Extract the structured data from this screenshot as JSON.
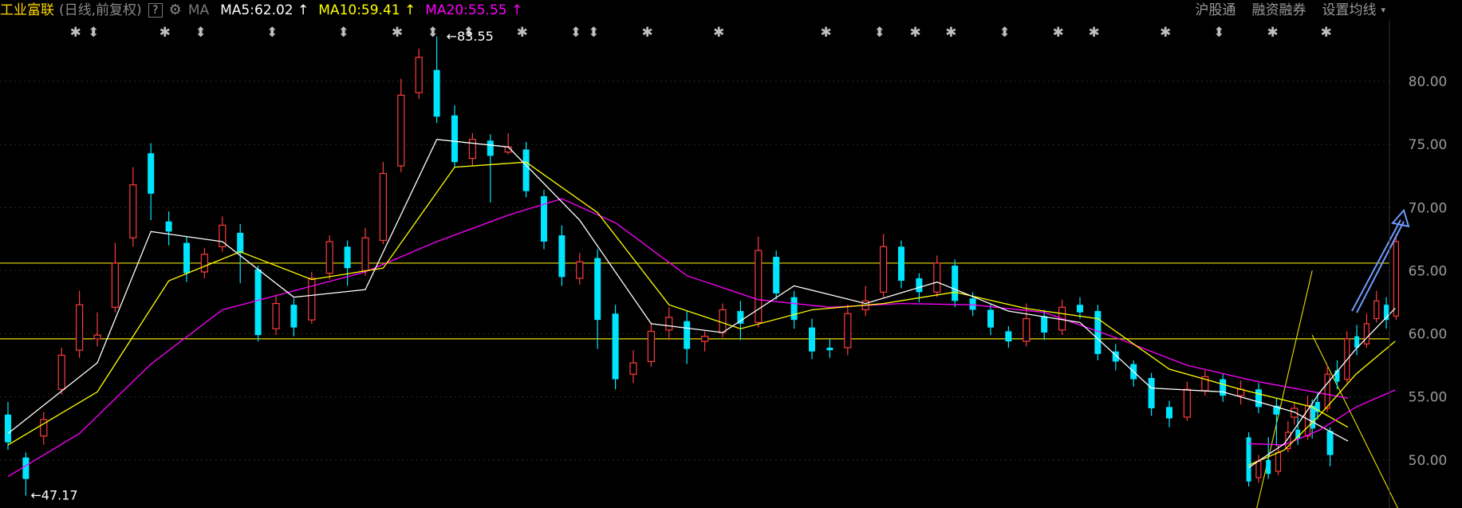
{
  "header": {
    "stock_name": "工业富联",
    "period": "(日线,前复权)",
    "help": "?",
    "gear_icon": "⚙",
    "ma_label": "MA",
    "ma5": "MA5:62.02 ↑",
    "ma10": "MA10:59.41 ↑",
    "ma20": "MA20:55.55 ↑",
    "buttons": [
      "沪股通",
      "融资融券",
      "设置均线"
    ],
    "caret": "▾"
  },
  "chart_data": {
    "type": "candlestick",
    "ylim": [
      46.2,
      84.8
    ],
    "yticks": [
      "80.00",
      "75.00",
      "70.00",
      "65.00",
      "60.00",
      "55.00",
      "50.00"
    ],
    "grid": "horizontal-dotted",
    "colors": {
      "up": "#ff3b3b",
      "down": "#00e5ff",
      "ma5": "#ffffff",
      "ma10": "#ffff00",
      "ma20": "#ff00ff",
      "guide": "#e8e000",
      "arrow": "#6f9bff"
    },
    "annotations": {
      "high": {
        "label": "←83.55",
        "value": 83.55,
        "index": 24
      },
      "low": {
        "label": "←47.17",
        "value": 47.17,
        "index": 1
      }
    },
    "horizontal_lines": [
      65.6,
      59.6
    ],
    "channel_lines": [
      {
        "from": [
          69.8,
          45.6
        ],
        "to": [
          73.0,
          65.0
        ]
      },
      {
        "from": [
          78.0,
          45.6
        ],
        "to": [
          73.0,
          59.9
        ]
      }
    ],
    "markers": [
      {
        "index": 2,
        "symbol": "✱"
      },
      {
        "index": 3,
        "symbol": "⬍"
      },
      {
        "index": 7,
        "symbol": "✱"
      },
      {
        "index": 9,
        "symbol": "⬍"
      },
      {
        "index": 13,
        "symbol": "⬍"
      },
      {
        "index": 17,
        "symbol": "⬍"
      },
      {
        "index": 20,
        "symbol": "✱"
      },
      {
        "index": 22,
        "symbol": "⬍"
      },
      {
        "index": 24,
        "symbol": "⬍"
      },
      {
        "index": 27,
        "symbol": "✱"
      },
      {
        "index": 30,
        "symbol": "⬍"
      },
      {
        "index": 31,
        "symbol": "⬍"
      },
      {
        "index": 34,
        "symbol": "✱"
      },
      {
        "index": 38,
        "symbol": "✱"
      },
      {
        "index": 44,
        "symbol": "✱"
      },
      {
        "index": 47,
        "symbol": "⬍"
      },
      {
        "index": 49,
        "symbol": "✱"
      },
      {
        "index": 51,
        "symbol": "✱"
      },
      {
        "index": 54,
        "symbol": "⬍"
      },
      {
        "index": 57,
        "symbol": "✱"
      },
      {
        "index": 59,
        "symbol": "✱"
      },
      {
        "index": 63,
        "symbol": "✱"
      },
      {
        "index": 66,
        "symbol": "⬍"
      },
      {
        "index": 69,
        "symbol": "✱"
      },
      {
        "index": 72,
        "symbol": "✱"
      }
    ],
    "candles": [
      [
        53.6,
        51.4,
        54.6,
        50.8
      ],
      [
        50.2,
        48.5,
        50.6,
        47.17
      ],
      [
        51.9,
        53.2,
        53.8,
        51.2
      ],
      [
        55.6,
        58.3,
        58.9,
        55.2
      ],
      [
        58.7,
        62.3,
        63.4,
        58.1
      ],
      [
        59.6,
        59.9,
        61.7,
        59.0
      ],
      [
        62.1,
        65.6,
        67.2,
        61.7
      ],
      [
        67.6,
        71.8,
        73.2,
        66.9
      ],
      [
        74.3,
        71.1,
        75.1,
        69.0
      ],
      [
        68.9,
        68.1,
        69.7,
        67.0
      ],
      [
        67.2,
        64.8,
        67.7,
        64.1
      ],
      [
        64.9,
        66.3,
        66.8,
        64.4
      ],
      [
        66.9,
        68.6,
        69.3,
        66.5
      ],
      [
        68.0,
        66.4,
        68.7,
        64.0
      ],
      [
        65.1,
        59.9,
        65.4,
        59.4
      ],
      [
        60.4,
        62.4,
        63.1,
        59.9
      ],
      [
        62.3,
        60.5,
        62.8,
        59.8
      ],
      [
        61.1,
        64.4,
        64.9,
        60.8
      ],
      [
        64.8,
        67.3,
        67.8,
        64.3
      ],
      [
        66.9,
        65.2,
        67.4,
        63.8
      ],
      [
        65.0,
        67.6,
        68.4,
        64.6
      ],
      [
        67.4,
        72.7,
        73.6,
        67.1
      ],
      [
        73.3,
        78.9,
        80.2,
        72.8
      ],
      [
        79.1,
        81.9,
        82.6,
        78.6
      ],
      [
        80.9,
        77.2,
        83.55,
        76.7
      ],
      [
        77.3,
        73.6,
        78.1,
        73.2
      ],
      [
        73.9,
        75.4,
        75.9,
        73.3
      ],
      [
        75.3,
        74.1,
        75.8,
        70.4
      ],
      [
        74.4,
        74.8,
        75.9,
        74.2
      ],
      [
        74.6,
        71.3,
        75.2,
        70.8
      ],
      [
        70.9,
        67.3,
        71.4,
        66.7
      ],
      [
        67.8,
        64.5,
        68.6,
        63.8
      ],
      [
        64.4,
        65.7,
        66.4,
        63.9
      ],
      [
        66.0,
        61.1,
        66.7,
        58.8
      ],
      [
        61.6,
        56.4,
        62.3,
        55.6
      ],
      [
        56.8,
        57.7,
        58.7,
        56.1
      ],
      [
        57.8,
        60.2,
        60.9,
        57.4
      ],
      [
        60.3,
        61.3,
        62.1,
        59.5
      ],
      [
        61.0,
        58.8,
        61.8,
        57.6
      ],
      [
        59.4,
        59.8,
        60.2,
        58.6
      ],
      [
        60.1,
        61.9,
        62.4,
        59.7
      ],
      [
        61.8,
        60.8,
        62.6,
        59.5
      ],
      [
        60.9,
        66.6,
        67.7,
        60.5
      ],
      [
        66.1,
        63.2,
        66.6,
        62.7
      ],
      [
        62.9,
        61.1,
        63.4,
        60.4
      ],
      [
        60.5,
        58.6,
        61.2,
        58.0
      ],
      [
        58.9,
        58.7,
        59.6,
        58.1
      ],
      [
        58.9,
        61.6,
        62.3,
        58.3
      ],
      [
        61.9,
        62.6,
        63.8,
        61.4
      ],
      [
        63.3,
        66.9,
        67.9,
        62.9
      ],
      [
        66.9,
        64.2,
        67.4,
        63.6
      ],
      [
        64.4,
        63.3,
        64.8,
        62.5
      ],
      [
        63.3,
        65.6,
        66.2,
        62.9
      ],
      [
        65.4,
        62.6,
        65.9,
        62.1
      ],
      [
        62.8,
        61.9,
        63.3,
        61.4
      ],
      [
        61.9,
        60.5,
        62.4,
        59.9
      ],
      [
        60.2,
        59.4,
        60.6,
        58.9
      ],
      [
        59.4,
        61.2,
        62.4,
        59.0
      ],
      [
        61.4,
        60.1,
        61.9,
        59.5
      ],
      [
        60.3,
        62.1,
        62.7,
        59.9
      ],
      [
        62.3,
        61.7,
        62.9,
        61.2
      ],
      [
        61.8,
        58.4,
        62.3,
        57.9
      ],
      [
        58.6,
        57.8,
        59.2,
        57.1
      ],
      [
        57.6,
        56.4,
        57.9,
        55.8
      ],
      [
        56.5,
        54.1,
        56.9,
        53.5
      ],
      [
        54.2,
        53.3,
        54.7,
        52.6
      ],
      [
        53.4,
        55.6,
        56.2,
        53.1
      ],
      [
        55.5,
        56.6,
        57.1,
        55.1
      ],
      [
        56.4,
        55.1,
        56.8,
        54.6
      ],
      [
        55.1,
        55.6,
        56.3,
        54.4
      ],
      [
        55.6,
        54.2,
        56.1,
        53.7
      ],
      [
        54.3,
        53.6,
        54.9,
        51.1
      ],
      [
        53.4,
        54.1,
        54.6,
        52.8
      ],
      [
        54.3,
        52.5,
        54.8,
        51.7
      ],
      [
        52.3,
        50.4,
        52.6,
        49.5
      ]
    ],
    "ma5": [
      [
        0,
        52.1
      ],
      [
        5,
        57.7
      ],
      [
        8,
        68.1
      ],
      [
        12,
        67.3
      ],
      [
        16,
        62.9
      ],
      [
        20,
        63.5
      ],
      [
        24,
        75.4
      ],
      [
        28,
        74.8
      ],
      [
        32,
        69.0
      ],
      [
        36,
        60.8
      ],
      [
        40,
        60.1
      ],
      [
        44,
        63.8
      ],
      [
        48,
        62.4
      ],
      [
        52,
        64.1
      ],
      [
        56,
        61.8
      ],
      [
        60,
        60.9
      ],
      [
        64,
        55.7
      ],
      [
        68,
        55.4
      ],
      [
        72,
        53.8
      ],
      [
        75,
        51.5
      ]
    ],
    "ma10": [
      [
        0,
        51.2
      ],
      [
        5,
        55.4
      ],
      [
        9,
        64.2
      ],
      [
        13,
        66.5
      ],
      [
        17,
        64.3
      ],
      [
        21,
        65.2
      ],
      [
        25,
        73.2
      ],
      [
        29,
        73.6
      ],
      [
        33,
        69.6
      ],
      [
        37,
        62.3
      ],
      [
        41,
        60.4
      ],
      [
        45,
        61.9
      ],
      [
        49,
        62.4
      ],
      [
        53,
        63.3
      ],
      [
        57,
        62.0
      ],
      [
        61,
        61.2
      ],
      [
        65,
        57.2
      ],
      [
        69,
        55.6
      ],
      [
        73,
        54.2
      ],
      [
        75,
        52.6
      ]
    ],
    "ma20": [
      [
        0,
        48.7
      ],
      [
        4,
        52.1
      ],
      [
        8,
        57.6
      ],
      [
        12,
        61.9
      ],
      [
        16,
        63.4
      ],
      [
        20,
        64.9
      ],
      [
        24,
        67.3
      ],
      [
        28,
        69.4
      ],
      [
        31,
        70.7
      ],
      [
        34,
        68.8
      ],
      [
        38,
        64.6
      ],
      [
        42,
        62.7
      ],
      [
        46,
        62.1
      ],
      [
        50,
        62.4
      ],
      [
        54,
        62.3
      ],
      [
        58,
        61.7
      ],
      [
        62,
        59.7
      ],
      [
        66,
        57.5
      ],
      [
        70,
        56.2
      ],
      [
        75,
        54.9
      ]
    ],
    "right_section": {
      "candles": [
        [
          51.8,
          48.3,
          52.2,
          47.9
        ],
        [
          48.6,
          49.9,
          50.4,
          48.2
        ],
        [
          50.0,
          48.9,
          51.8,
          48.5
        ],
        [
          49.1,
          50.6,
          51.2,
          48.8
        ],
        [
          50.9,
          52.2,
          53.1,
          50.6
        ],
        [
          52.4,
          51.7,
          53.4,
          51.2
        ],
        [
          51.9,
          54.3,
          55.1,
          51.6
        ],
        [
          54.6,
          53.8,
          55.4,
          53.2
        ],
        [
          54.1,
          56.8,
          57.5,
          53.8
        ],
        [
          57.1,
          56.2,
          57.9,
          55.6
        ],
        [
          56.4,
          59.6,
          60.2,
          56.1
        ],
        [
          59.8,
          58.9,
          60.7,
          58.3
        ],
        [
          59.2,
          60.8,
          61.6,
          58.9
        ],
        [
          61.2,
          62.6,
          63.4,
          60.9
        ],
        [
          62.3,
          61.1,
          62.9,
          60.4
        ],
        [
          61.4,
          67.3,
          67.9,
          61.1
        ]
      ],
      "x_start": 69.0,
      "x_step": 0.55,
      "ma5": [
        [
          69.0,
          49.4
        ],
        [
          71.0,
          51.3
        ],
        [
          73.0,
          55.4
        ],
        [
          75.0,
          58.8
        ],
        [
          77.2,
          62.02
        ]
      ],
      "ma10": [
        [
          69.0,
          49.6
        ],
        [
          71.0,
          50.8
        ],
        [
          73.0,
          53.6
        ],
        [
          75.0,
          56.8
        ],
        [
          77.2,
          59.41
        ]
      ],
      "ma20": [
        [
          69.0,
          51.3
        ],
        [
          71.0,
          51.2
        ],
        [
          73.0,
          52.4
        ],
        [
          75.0,
          54.2
        ],
        [
          77.2,
          55.55
        ]
      ]
    }
  }
}
